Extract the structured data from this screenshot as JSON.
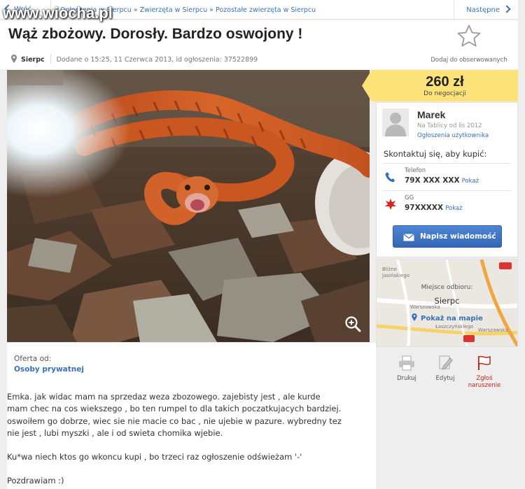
{
  "watermark": "www.wiocha.pl",
  "topbar": {
    "back_label": "Wróć",
    "breadcrumbs": [
      "Ogłoszenia w Sierpcu",
      "Zwierzęta w Sierpcu",
      "Pozostałe zwierzęta w Sierpcu"
    ],
    "separator": "»",
    "next_label": "Następne"
  },
  "ad": {
    "title": "Wąż zbożowy. Dorosły. Bardzo oswojony !",
    "city": "Sierpc",
    "added": "Dodane o 15:25, 11 Czerwca 2013, id ogłoszenia: 37522899",
    "observe_label": "Dodaj do obserwowanych"
  },
  "price": {
    "value": "260 zł",
    "note": "Do negocjacji"
  },
  "seller": {
    "name": "Marek",
    "since": "Na Tablicy od lis 2012",
    "user_ads_link": "Ogłoszenia użytkownika",
    "contact_heading": "Skontaktuj się, aby kupić:",
    "phone_label": "Telefon",
    "phone_value": "79X XXX XXX",
    "show_label": "Pokaż",
    "gg_label": "GG",
    "gg_value": "97XXXXX",
    "message_button": "Napisz wiadomość"
  },
  "map": {
    "pickup_label": "Miejsce odbioru:",
    "pickup_city": "Sierpc",
    "show_map_link": "Pokaż na mapie",
    "labels": [
      "Bliżne",
      "Jasińskiego",
      "Warszawska",
      "Łaszczyńskiego",
      "Warszawska"
    ]
  },
  "actions": {
    "print": "Drukuj",
    "edit": "Edytuj",
    "report_line1": "Zgłoś",
    "report_line2": "naruszenie"
  },
  "description": {
    "offer_label": "Oferta od:",
    "offer_value": "Osoby prywatnej",
    "lines": [
      "Emka. jak widac mam na sprzedaz weza zbozowego. zajebisty jest , ale kurde",
      "mam chec na cos wiekszego , bo ten rumpel to dla takich poczatkujacych bardziej.",
      "oswoiłem go dobrze, wiec sie nie macie co bac , nie ujebie w pazure. wybredny tez",
      "nie jest , lubi myszki , ale i od swieta chomika wjebie.",
      "Ku*wa niech ktos go wkoncu kupi , bo trzeci raz ogłoszenie odświeżam '-'",
      "Pozdrawiam :)"
    ]
  },
  "colors": {
    "link": "#3a70b7",
    "price_bg": "#fde27a",
    "button": "#3f78c6",
    "report": "#c2241b"
  },
  "icons": [
    "chevron-left-icon",
    "chevron-right-icon",
    "location-pin-icon",
    "star-icon",
    "zoom-icon",
    "avatar-icon",
    "phone-icon",
    "gg-icon",
    "envelope-icon",
    "map-pin-icon",
    "print-icon",
    "edit-icon",
    "flag-icon"
  ]
}
